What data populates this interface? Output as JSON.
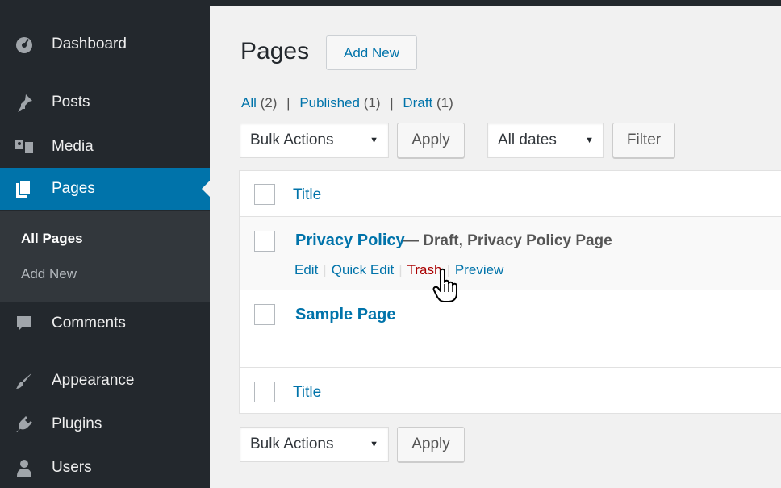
{
  "sidebar": {
    "items": [
      {
        "label": "Dashboard",
        "icon": "dashboard-icon"
      },
      {
        "label": "Posts",
        "icon": "pin-icon"
      },
      {
        "label": "Media",
        "icon": "media-icon"
      },
      {
        "label": "Pages",
        "icon": "pages-icon",
        "current": true
      },
      {
        "label": "Comments",
        "icon": "comment-icon"
      },
      {
        "label": "Appearance",
        "icon": "brush-icon"
      },
      {
        "label": "Plugins",
        "icon": "plugin-icon"
      },
      {
        "label": "Users",
        "icon": "user-icon"
      }
    ],
    "submenu": [
      {
        "label": "All Pages",
        "active": true
      },
      {
        "label": "Add New"
      }
    ]
  },
  "main": {
    "title": "Pages",
    "add_new": "Add New",
    "filters": {
      "all_label": "All",
      "all_count": "(2)",
      "published_label": "Published",
      "published_count": "(1)",
      "draft_label": "Draft",
      "draft_count": "(1)",
      "separator": "|"
    },
    "top_bulk_actions": "Bulk Actions",
    "top_apply": "Apply",
    "dates": "All dates",
    "filter": "Filter",
    "bottom_bulk_actions": "Bulk Actions",
    "bottom_apply": "Apply"
  },
  "table": {
    "header_title": "Title",
    "footer_title": "Title",
    "rows": [
      {
        "title": "Privacy Policy",
        "state": " — Draft, Privacy Policy Page",
        "actions": [
          "Edit",
          "Quick Edit",
          "Trash",
          "Preview"
        ]
      },
      {
        "title": "Sample Page"
      }
    ]
  },
  "colors": {
    "accent": "#0073aa",
    "sidebar": "#23282d",
    "trash": "#a00000"
  }
}
